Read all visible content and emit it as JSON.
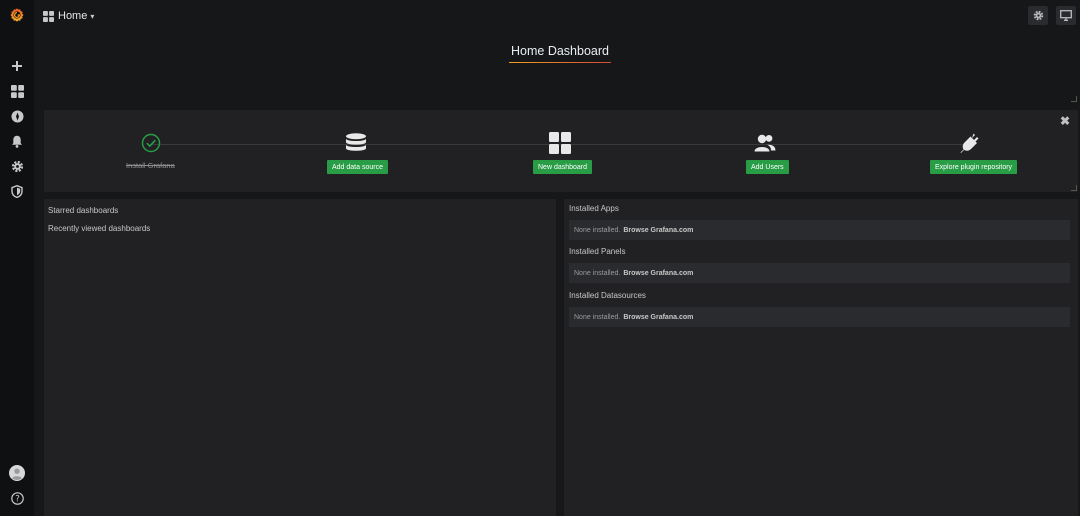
{
  "nav": {
    "home_label": "Home",
    "caret": "▾"
  },
  "dashboard": {
    "title": "Home Dashboard"
  },
  "getting_started": {
    "close_glyph": "✖",
    "steps": [
      {
        "label": "Install Grafana",
        "state": "done",
        "icon": "check-circle-icon"
      },
      {
        "label": "Add data source",
        "state": "todo",
        "icon": "database-icon"
      },
      {
        "label": "New dashboard",
        "state": "todo",
        "icon": "apps-icon"
      },
      {
        "label": "Add Users",
        "state": "todo",
        "icon": "users-icon"
      },
      {
        "label": "Explore plugin repository",
        "state": "todo",
        "icon": "plug-icon"
      }
    ]
  },
  "left_panel": {
    "starred": "Starred dashboards",
    "recent": "Recently viewed dashboards"
  },
  "right_panel": {
    "sections": [
      {
        "heading": "Installed Apps",
        "empty_text": "None installed.",
        "link": "Browse Grafana.com"
      },
      {
        "heading": "Installed Panels",
        "empty_text": "None installed.",
        "link": "Browse Grafana.com"
      },
      {
        "heading": "Installed Datasources",
        "empty_text": "None installed.",
        "link": "Browse Grafana.com"
      }
    ]
  },
  "colors": {
    "sidebar_bg": "#0f1012",
    "page_bg": "#161719",
    "panel_bg": "#212124",
    "accent_green": "#299c46",
    "brand_orange": "#f05a28"
  }
}
